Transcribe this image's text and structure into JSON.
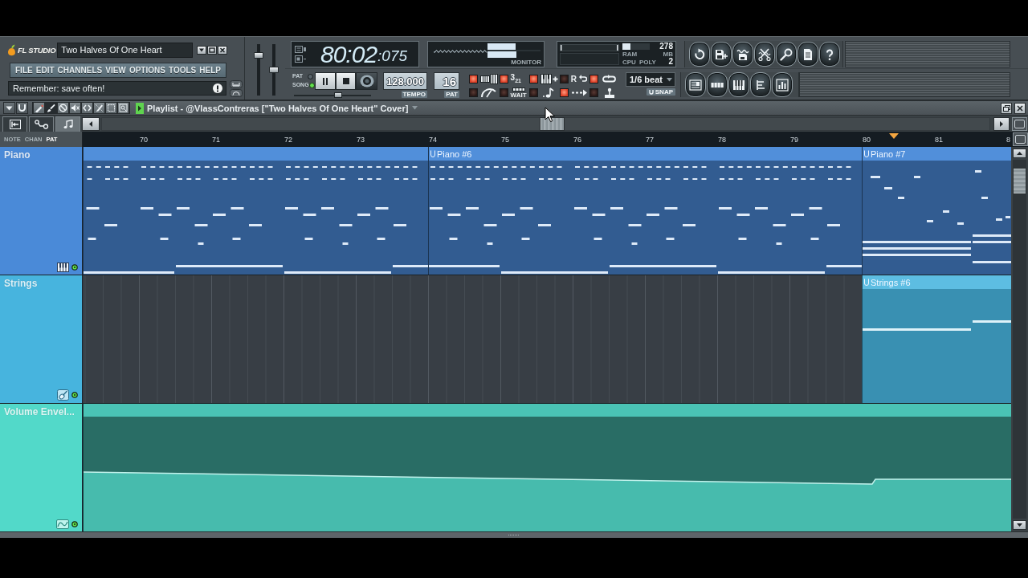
{
  "app": {
    "logo": "FL STUDIO",
    "title": "Two Halves Of One Heart"
  },
  "menu": [
    "FILE",
    "EDIT",
    "CHANNELS",
    "VIEW",
    "OPTIONS",
    "TOOLS",
    "HELP"
  ],
  "hint": "Remember: save often!",
  "sliders": [
    {
      "level": 0.82
    },
    {
      "level": 0.5
    }
  ],
  "transport": {
    "modes": [
      {
        "label": "PAT",
        "selected": false
      },
      {
        "label": "SONG",
        "selected": true
      }
    ],
    "time": "80:02",
    "ticks": ":075",
    "monitor_label": "MONITOR",
    "position": {
      "level": 0.58
    },
    "tempo": "128.000",
    "tempo_label": "TEMPO",
    "pattern": "16",
    "pattern_label": "PAT"
  },
  "performance": {
    "ram_meter": {
      "level": 0.3
    },
    "ram": "278",
    "ram_label": "RAM",
    "ram_unit": "MB",
    "cpu_label": "CPU",
    "poly_label": "POLY",
    "polyphony": "2"
  },
  "toggles": [
    {
      "kind": "typing",
      "on": true
    },
    {
      "kind": "countdown",
      "label": "3$_{2}$$_{1}$",
      "on": true
    },
    {
      "kind": "step",
      "on": true
    },
    {
      "kind": "record",
      "label": "R",
      "on": false
    },
    {
      "kind": "loop",
      "on": true
    },
    {
      "kind": "metronome",
      "on": false
    },
    {
      "kind": "wait",
      "label": "WAIT",
      "on": false
    },
    {
      "kind": "note",
      "on": false
    },
    {
      "kind": "overdub",
      "on": true
    },
    {
      "kind": "joystick",
      "on": false
    }
  ],
  "snap": {
    "value": "1/6 beat",
    "label": "SNAP"
  },
  "playlist": {
    "title": "Playlist - @VlassContreras [\"Two Halves Of One Heart\" Cover]",
    "tools": [
      {
        "kind": "pencil",
        "selected": false
      },
      {
        "kind": "brush",
        "selected": true
      },
      {
        "kind": "delete",
        "selected": false
      },
      {
        "kind": "mute",
        "selected": false
      },
      {
        "kind": "slip",
        "selected": false
      },
      {
        "kind": "slice",
        "selected": false
      },
      {
        "kind": "select",
        "selected": false
      },
      {
        "kind": "zoom",
        "selected": false
      }
    ],
    "tabs": [
      {
        "kind": "pattern",
        "selected": false
      },
      {
        "kind": "automation",
        "selected": false
      },
      {
        "kind": "audio",
        "selected": true
      }
    ],
    "filters": [
      {
        "label": "NOTE",
        "selected": false
      },
      {
        "label": "CHAN",
        "selected": false
      },
      {
        "label": "PAT",
        "selected": true
      }
    ],
    "bars": [
      "70",
      "71",
      "72",
      "73",
      "74",
      "75",
      "76",
      "77",
      "78",
      "79",
      "80",
      "81",
      "8"
    ],
    "tracks": [
      {
        "name": "Piano",
        "kind": "keys",
        "color": "#4a8ad8",
        "enabled": true,
        "lead_clip": true,
        "clips": [
          "Piano #6",
          "Piano #7"
        ]
      },
      {
        "name": "Strings",
        "kind": "strings",
        "color": "#47b4de",
        "enabled": true,
        "lead_clip": false,
        "clips": [
          "Strings #6"
        ]
      },
      {
        "name": "Volume Envel...",
        "kind": "automation",
        "color": "#52d9c9",
        "enabled": true,
        "lead_clip": true
      }
    ]
  }
}
